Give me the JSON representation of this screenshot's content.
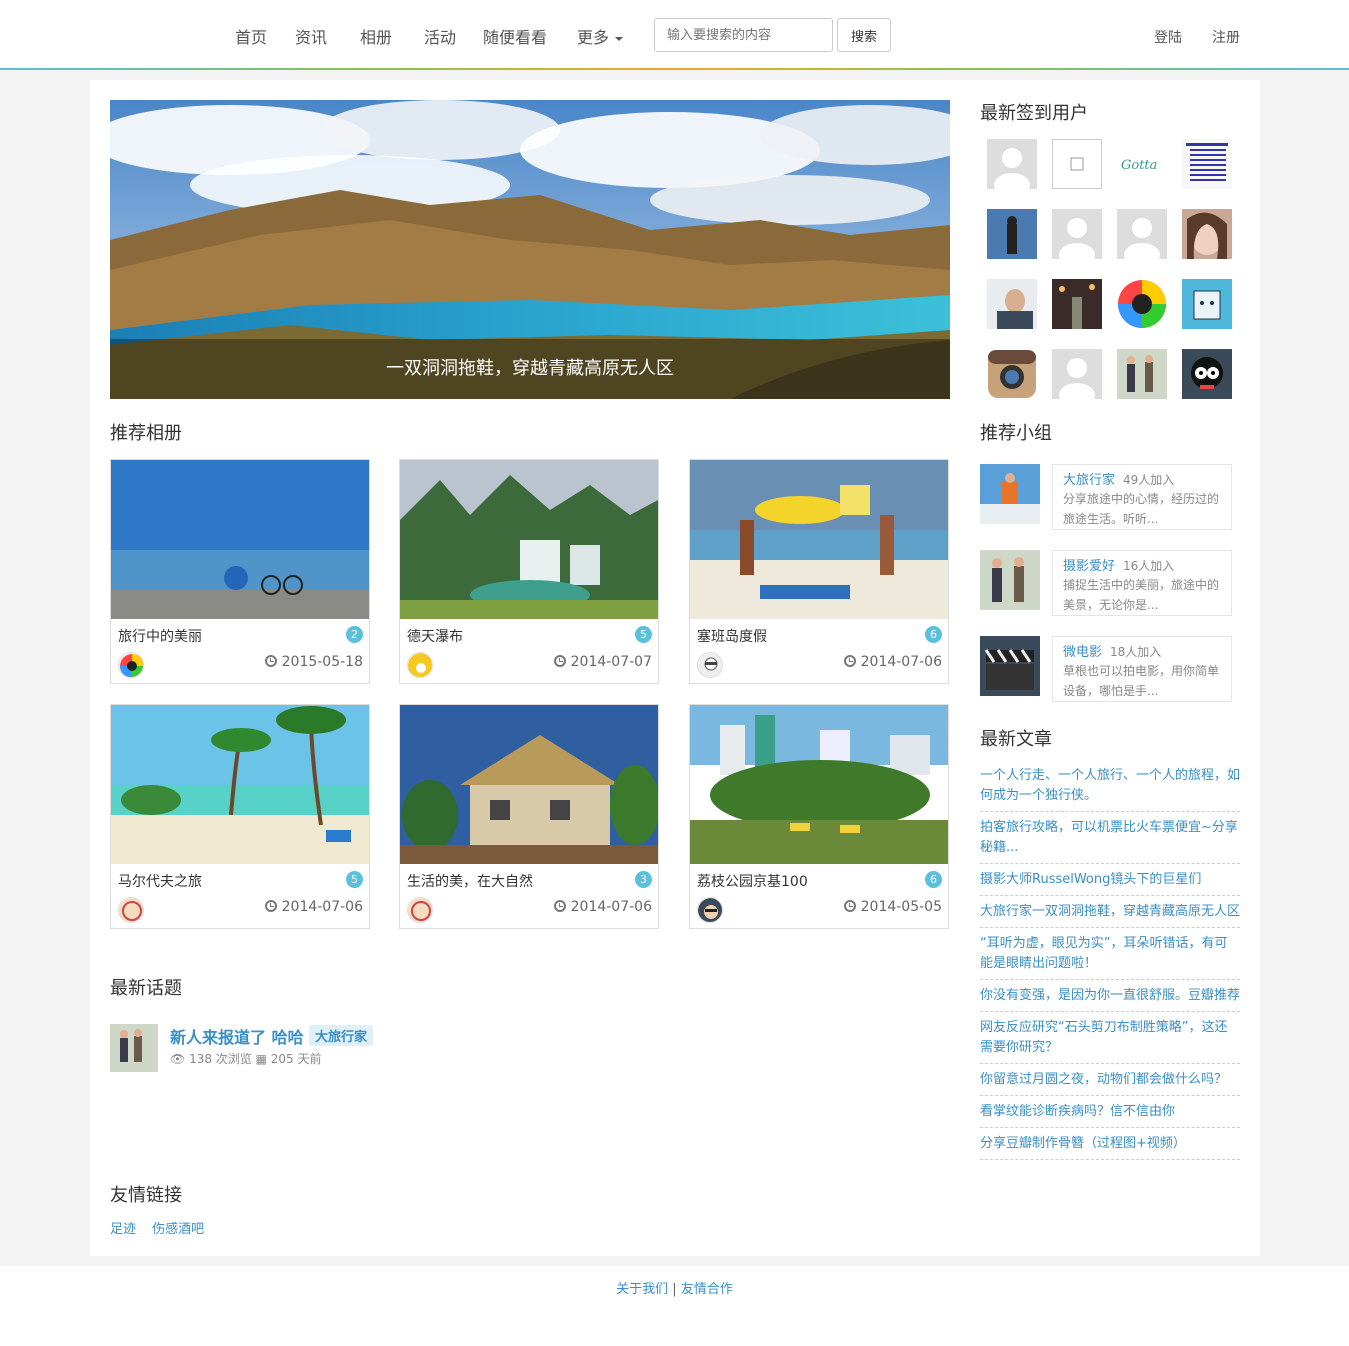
{
  "nav": {
    "items": [
      "首页",
      "资讯",
      "相册",
      "活动",
      "随便看看",
      "更多"
    ],
    "search_placeholder": "输入要搜索的内容",
    "search_label": "搜索",
    "login": "登陆",
    "register": "注册"
  },
  "hero": {
    "caption": "一双洞洞拖鞋，穿越青藏高原无人区"
  },
  "albums": {
    "title": "推荐相册",
    "items": [
      {
        "title": "旅行中的美丽",
        "count": "2",
        "date": "2015-05-18"
      },
      {
        "title": "德天瀑布",
        "count": "5",
        "date": "2014-07-07"
      },
      {
        "title": "塞班岛度假",
        "count": "6",
        "date": "2014-07-06"
      },
      {
        "title": "马尔代夫之旅",
        "count": "5",
        "date": "2014-07-06"
      },
      {
        "title": "生活的美，在大自然",
        "count": "3",
        "date": "2014-07-06"
      },
      {
        "title": "荔枝公园京基100",
        "count": "6",
        "date": "2014-05-05"
      }
    ]
  },
  "topics": {
    "title": "最新话题",
    "items": [
      {
        "title": "新人来报道了 哈哈",
        "tag": "大旅行家",
        "meta": "138 次浏览 ▦ 205 天前"
      }
    ]
  },
  "friend_links": {
    "title": "友情链接",
    "items": [
      "足迹",
      "伤感酒吧"
    ]
  },
  "sidebar": {
    "users_title": "最新签到用户",
    "groups_title": "推荐小组",
    "groups": [
      {
        "name": "大旅行家",
        "count": "49人加入",
        "desc": "分享旅途中的心情，经历过的旅途生活。听听..."
      },
      {
        "name": "摄影爱好",
        "count": "16人加入",
        "desc": "捕捉生活中的美丽，旅途中的美景，无论你是..."
      },
      {
        "name": "微电影",
        "count": "18人加入",
        "desc": "草根也可以拍电影，用你简单设备，哪怕是手..."
      }
    ],
    "articles_title": "最新文章",
    "articles": [
      "一个人行走、一个人旅行、一个人的旅程，如何成为一个独行侠。",
      "拍客旅行攻略，可以机票比火车票便宜~分享秘籍...",
      "摄影大师RusselWong镜头下的巨星们",
      "大旅行家一双洞洞拖鞋，穿越青藏高原无人区",
      "“耳听为虚，眼见为实”，耳朵听错话，有可能是眼睛出问题啦！",
      "你没有变强，是因为你一直很舒服。豆瓣推荐",
      "网友反应研究“石头剪刀布制胜策略”，这还需要你研究？",
      "你留意过月圆之夜，动物们都会做什么吗？",
      "看掌纹能诊断疾病吗？信不信由你",
      "分享豆瓣制作骨簪（过程图+视频）"
    ]
  },
  "footer": {
    "about": "关于我们",
    "sep": "|",
    "coop": "友情合作"
  }
}
